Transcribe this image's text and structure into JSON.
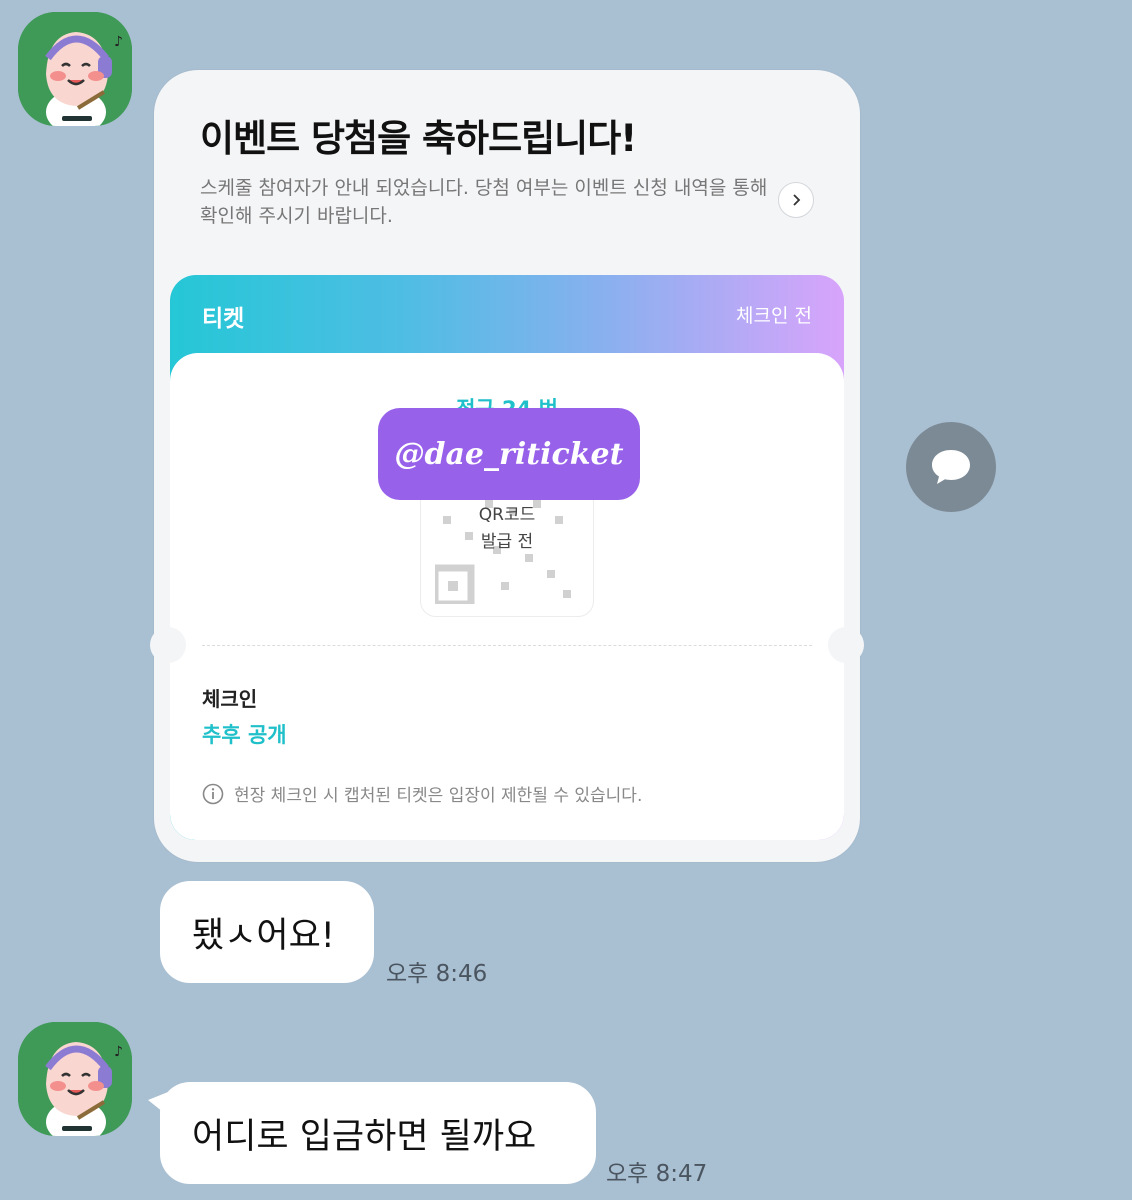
{
  "card": {
    "title": "이벤트 당첨을 축하드립니다!",
    "description": "스케줄 참여자가 안내 되었습니다. 당첨 여부는 이벤트 신청 내역을 통해 확인해 주시기 바랍니다."
  },
  "ticket": {
    "title": "티켓",
    "status": "체크인 전",
    "seat": "정규 24  번",
    "qr_line1": "QR코드",
    "qr_line2": "발급 전",
    "watermark": "@dae_riticket",
    "checkin_label": "체크인",
    "checkin_value": "추후 공개",
    "notice": "현장 체크인 시 캡처된 티켓은 입장이 제한될 수 있습니다."
  },
  "messages": [
    {
      "text": "됐ㅅ어요!",
      "time": "오후 8:46"
    },
    {
      "text": "어디로 입금하면 될까요",
      "time": "오후 8:47"
    }
  ],
  "icons": {
    "avatar": "peach-character-avatar-icon",
    "arrow": "chevron-right-icon",
    "share": "speech-bubble-icon",
    "info": "info-icon"
  }
}
